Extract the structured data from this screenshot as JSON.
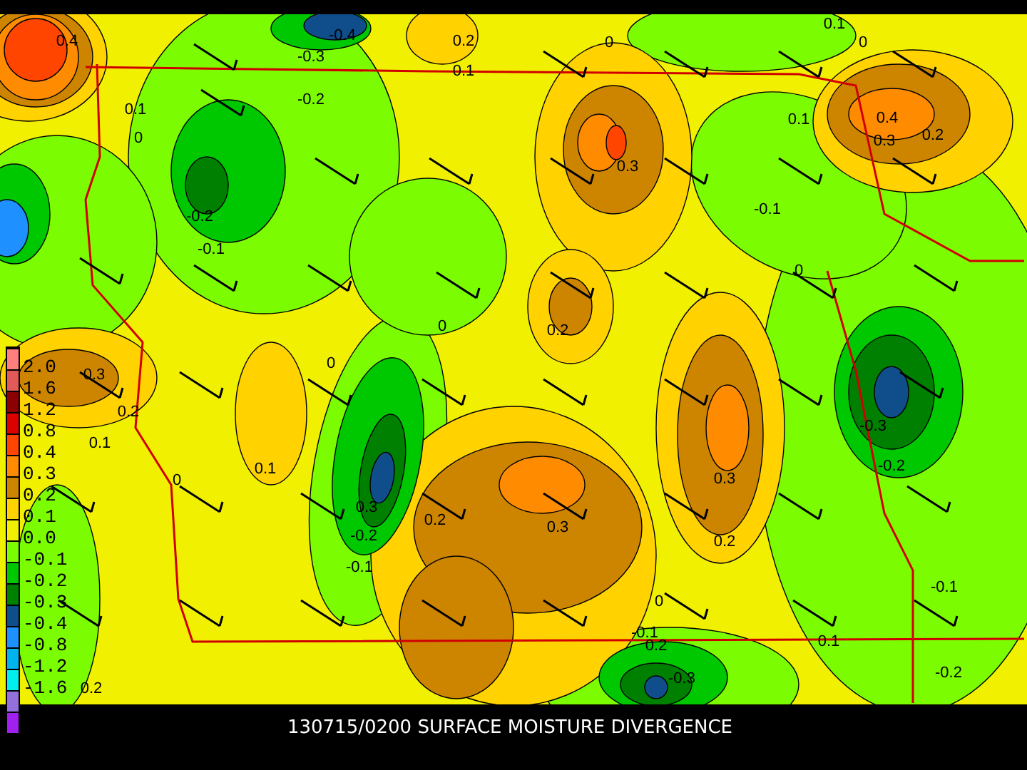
{
  "map": {
    "contour_labels": [
      "0.4",
      "-0.4",
      "-0.3",
      "0.2",
      "0.1",
      "0",
      "0.1",
      "0",
      "-0.2",
      "0.1",
      "0",
      "0.4",
      "0.3",
      "0.2",
      "0.1",
      "0.3",
      "-0.1",
      "-0.2",
      "-0.1",
      "0",
      "0",
      "0.2",
      "0",
      "0.3",
      "0.2",
      "0.1",
      "0.1",
      "0.3",
      "-0.3",
      "-0.2",
      "0",
      "0.3",
      "0.2",
      "0.3",
      "0.2",
      "-0.2",
      "-0.1",
      "-0.1",
      "-0.1",
      "0.2",
      "-0.3",
      "0.1",
      "-0.2",
      "0.2",
      "0"
    ]
  },
  "legend": {
    "bands": [
      {
        "color": "#ff7f7f"
      },
      {
        "color": "#e05a5a"
      },
      {
        "color": "#8b0000"
      },
      {
        "color": "#dd0000"
      },
      {
        "color": "#ff4500"
      },
      {
        "color": "#ff8c00"
      },
      {
        "color": "#cd8500"
      },
      {
        "color": "#ffd200"
      },
      {
        "color": "#f0f000"
      },
      {
        "color": "#7cfc00"
      },
      {
        "color": "#00c800"
      },
      {
        "color": "#008000"
      },
      {
        "color": "#104e8b"
      },
      {
        "color": "#1e90ff"
      },
      {
        "color": "#00b2ee"
      },
      {
        "color": "#00eeee"
      },
      {
        "color": "#9370db"
      },
      {
        "color": "#a020f0"
      }
    ],
    "labels": [
      "2.0",
      "1.6",
      "1.2",
      "0.8",
      "0.4",
      "0.3",
      "0.2",
      "0.1",
      "0.0",
      "-0.1",
      "-0.2",
      "-0.3",
      "-0.4",
      "-0.8",
      "-1.2",
      "-1.6"
    ]
  },
  "title": "130715/0200 SURFACE MOISTURE DIVERGENCE"
}
